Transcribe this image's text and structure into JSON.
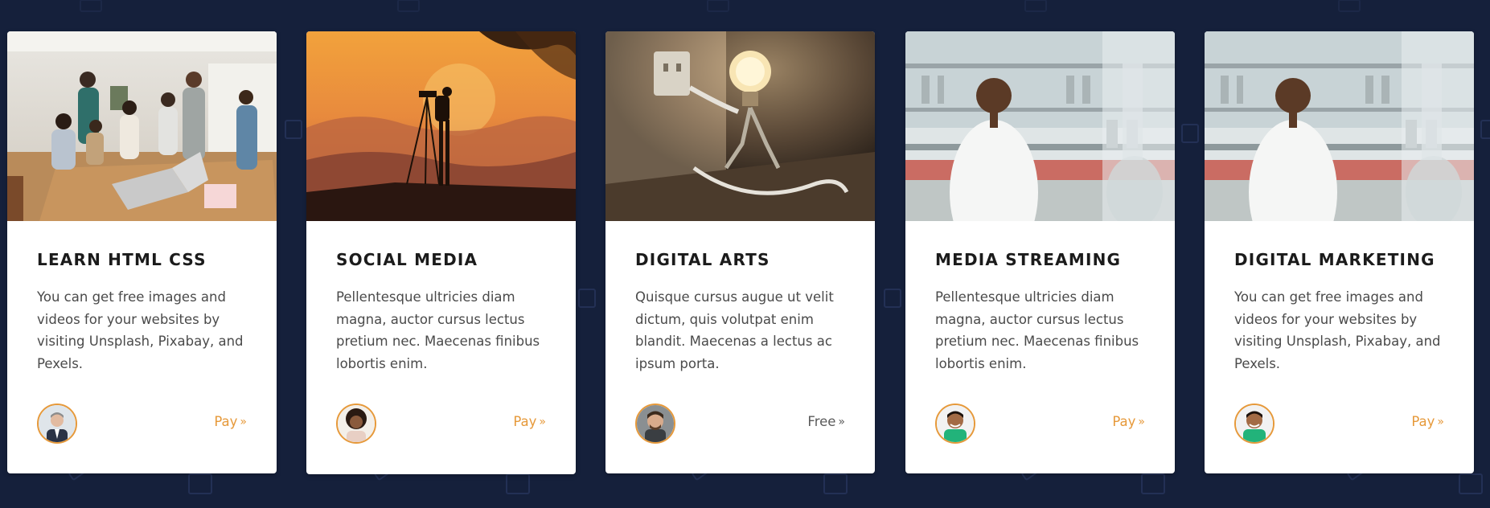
{
  "theme": {
    "background": "#15203b",
    "card_background": "#ffffff",
    "accent": "#e6993a",
    "free_color": "#5a5a5a"
  },
  "cards": [
    {
      "image": "team-around-laptop-photo",
      "title": "LEARN HTML CSS",
      "description": "You can get free images and videos for your websites by visiting Unsplash, Pixabay, and Pexels.",
      "avatar": "man-in-suit-avatar",
      "price_label": "Pay",
      "price_icon": "double-chevron-right-icon"
    },
    {
      "image": "sunset-photographer-photo",
      "title": "SOCIAL MEDIA",
      "description": "Pellentesque ultricies diam magna, auctor cursus lectus pretium nec. Maecenas finibus lobortis enim.",
      "avatar": "woman-curly-hair-avatar",
      "price_label": "Pay",
      "price_icon": "double-chevron-right-icon"
    },
    {
      "image": "lightbulb-plug-photo",
      "title": "DIGITAL ARTS",
      "description": "Quisque cursus augue ut velit dictum, quis volutpat enim blandit. Maecenas a lectus ac ipsum porta.",
      "avatar": "bearded-man-avatar",
      "price_label": "Free",
      "price_icon": "double-chevron-right-icon"
    },
    {
      "image": "lab-scientist-photo",
      "title": "MEDIA STREAMING",
      "description": "Pellentesque ultricies diam magna, auctor cursus lectus pretium nec. Maecenas finibus lobortis enim.",
      "avatar": "smiling-man-green-shirt-avatar",
      "price_label": "Pay",
      "price_icon": "double-chevron-right-icon"
    },
    {
      "image": "lab-scientist-photo",
      "title": "DIGITAL MARKETING",
      "description": "You can get free images and videos for your websites by visiting Unsplash, Pixabay, and Pexels.",
      "avatar": "smiling-man-green-shirt-avatar",
      "price_label": "Pay",
      "price_icon": "double-chevron-right-icon"
    }
  ]
}
